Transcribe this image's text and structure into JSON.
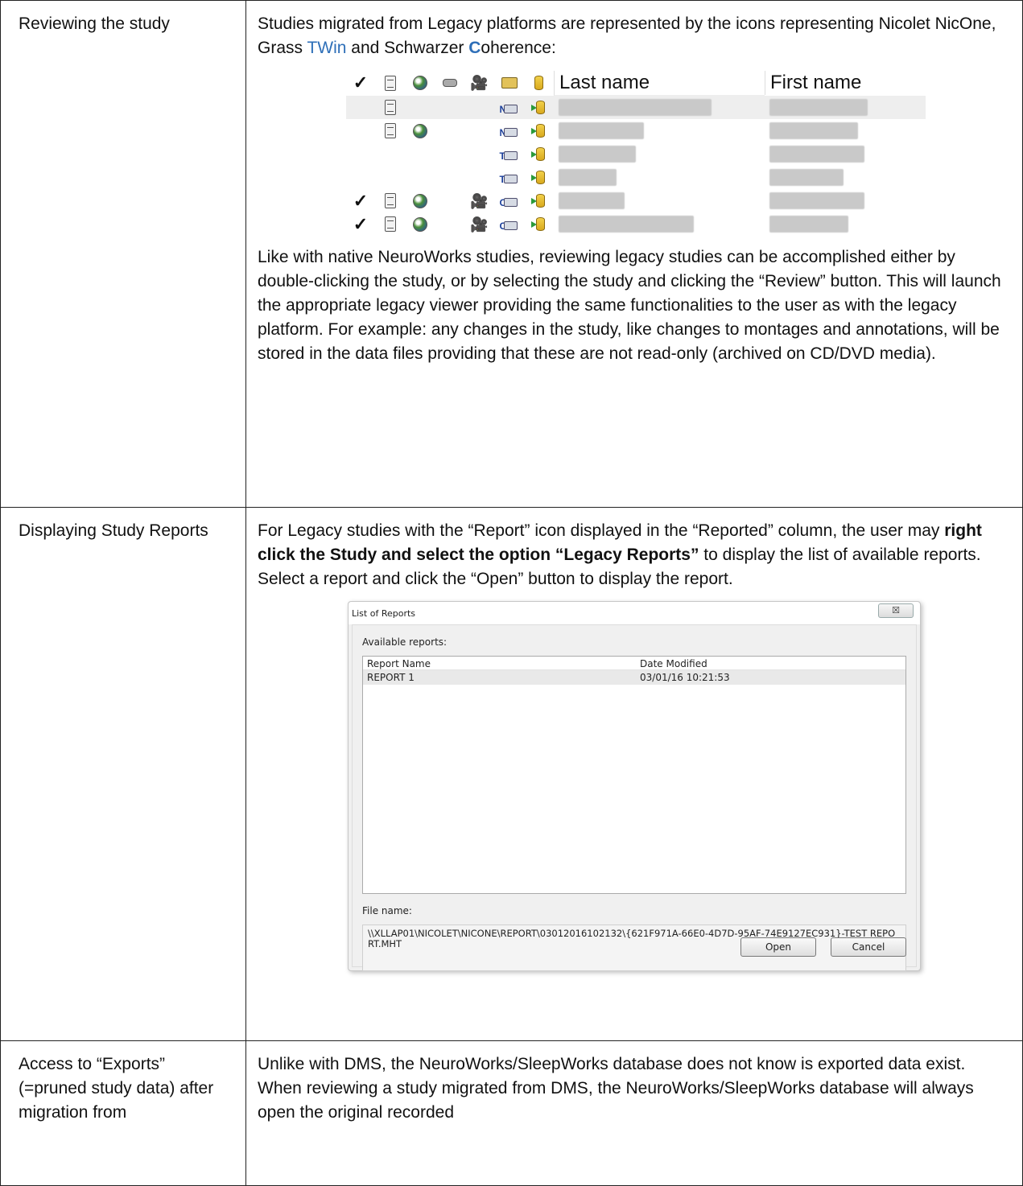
{
  "rows": {
    "reviewing": {
      "label": "Reviewing the study",
      "intro_before_twin": "Studies migrated from Legacy platforms are represented by the icons representing Nicolet NicOne, Grass ",
      "twin": "TWin",
      "intro_between": " and Schwarzer ",
      "c_letter": "C",
      "intro_after": "oherence:",
      "paragraph": "Like with native NeuroWorks studies, reviewing legacy studies can be accomplished either by double-clicking the study, or by selecting the study and clicking the “Review” button. This will launch the appropriate legacy viewer providing the same functionalities to the user as with the legacy platform. For example: any changes in the study, like changes to montages and annotations, will be stored in the data files providing that these are not read-only (archived on CD/DVD media)."
    },
    "reports": {
      "label": "Displaying Study Reports",
      "text_before_bold": "For Legacy studies with the “Report” icon displayed in the “Reported” column, the user may ",
      "bold": "right click the Study and select the option “Legacy Reports”",
      "text_after_bold": " to display the list of available reports. Select a report and click the “Open” button to display the report."
    },
    "exports": {
      "label": "Access to “Exports” (=pruned study data) after migration from",
      "paragraph": "Unlike with DMS, the NeuroWorks/SleepWorks database does not know is exported data exist. When reviewing a study migrated from DMS, the NeuroWorks/SleepWorks database will always open the original recorded"
    }
  },
  "study_grid": {
    "headers": {
      "last_name": "Last name",
      "first_name": "First name"
    },
    "header_icons": [
      "checkmark",
      "notes-icon",
      "globe-icon",
      "pill-icon",
      "camera-icon",
      "folder-icon",
      "database-icon"
    ],
    "check_glyph": "✓",
    "system_letters": [
      "N",
      "N",
      "T",
      "T",
      "C",
      "C"
    ]
  },
  "dialog": {
    "title": "List of Reports",
    "close": "☒",
    "available_label": "Available reports:",
    "columns": [
      "Report Name",
      "Date Modified"
    ],
    "rows": [
      {
        "name": "REPORT 1",
        "date": "03/01/16 10:21:53"
      }
    ],
    "file_name_label": "File name:",
    "file_name_value": "\\\\XLLAP01\\NICOLET\\NICONE\\REPORT\\03012016102132\\{621F971A-66E0-4D7D-95AF-74E9127EC931}-TEST REPORT.MHT",
    "open_button": "Open",
    "cancel_button": "Cancel"
  }
}
